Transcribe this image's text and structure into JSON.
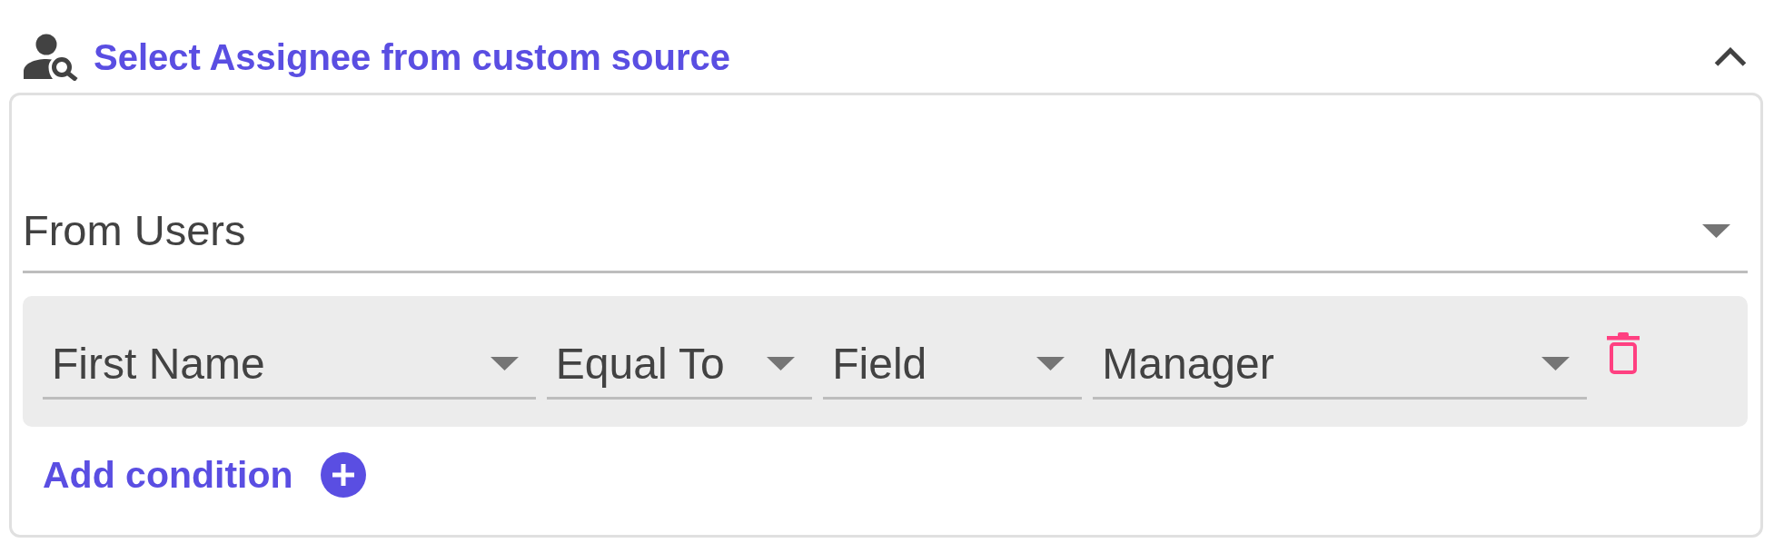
{
  "section": {
    "title": "Select Assignee from custom source",
    "expanded": true
  },
  "source": {
    "value": "From Users"
  },
  "conditions": [
    {
      "selects": [
        {
          "value": "First Name"
        },
        {
          "value": "Equal To"
        },
        {
          "value": "Field"
        },
        {
          "value": "Manager"
        }
      ]
    }
  ],
  "add_condition": {
    "label": "Add condition"
  }
}
